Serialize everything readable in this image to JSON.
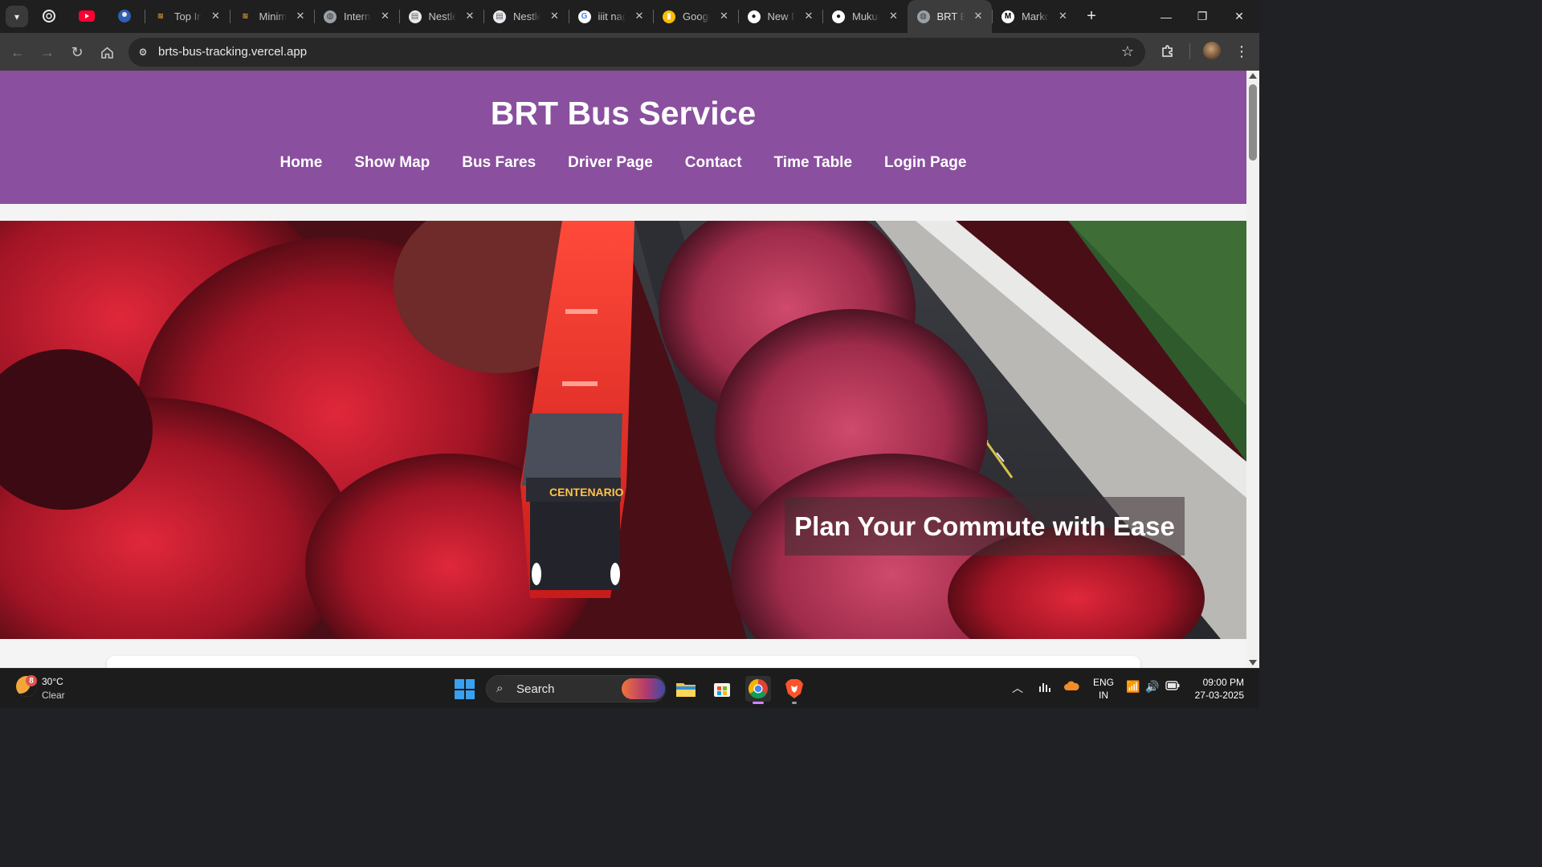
{
  "browser": {
    "tabs": [
      {
        "title": "Top Interview",
        "favicon_icon": "hashnode-icon",
        "active": false
      },
      {
        "title": "Minimum",
        "favicon_icon": "hashnode-icon",
        "active": false
      },
      {
        "title": "Internet",
        "favicon_icon": "globe-icon",
        "active": false
      },
      {
        "title": "Nestlé",
        "favicon_icon": "document-icon",
        "active": false
      },
      {
        "title": "Nestlé",
        "favicon_icon": "document-icon",
        "active": false
      },
      {
        "title": "iiit nagpur",
        "favicon_icon": "google-icon",
        "active": false
      },
      {
        "title": "Google Keep",
        "favicon_icon": "keep-icon",
        "active": false
      },
      {
        "title": "New Repository",
        "favicon_icon": "github-icon",
        "active": false
      },
      {
        "title": "Mukund",
        "favicon_icon": "github-icon",
        "active": false
      },
      {
        "title": "BRT Bus Service",
        "favicon_icon": "globe-icon",
        "active": true
      },
      {
        "title": "Markdown",
        "favicon_icon": "medium-icon",
        "active": false
      }
    ],
    "url": "brts-bus-tracking.vercel.app"
  },
  "site": {
    "title": "BRT Bus Service",
    "nav": [
      "Home",
      "Show Map",
      "Bus Fares",
      "Driver Page",
      "Contact",
      "Time Table",
      "Login Page"
    ],
    "hero_caption": "Plan Your Commute with Ease",
    "accent_color": "#8a4f9e"
  },
  "taskbar": {
    "weather_temp": "30°C",
    "weather_condition": "Clear",
    "weather_badge": "8",
    "search_label": "Search",
    "lang_primary": "ENG",
    "lang_secondary": "IN",
    "time": "09:00 PM",
    "date": "27-03-2025"
  }
}
